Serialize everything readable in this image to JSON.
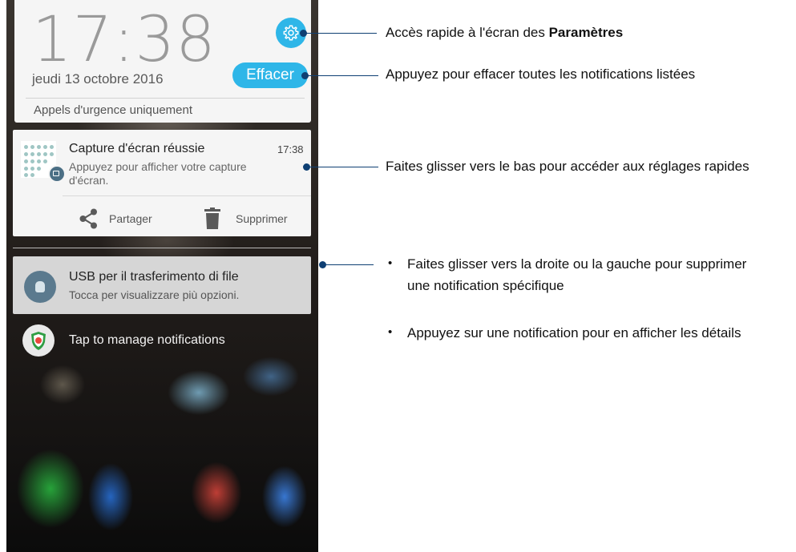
{
  "lockscreen": {
    "time": "17:38",
    "date": "jeudi 13 octobre 2016",
    "clear_label": "Effacer",
    "emergency_text": "Appels d'urgence uniquement"
  },
  "screenshot_notification": {
    "title": "Capture d'écran réussie",
    "time": "17:38",
    "text": "Appuyez pour afficher votre capture d'écran.",
    "share_label": "Partager",
    "delete_label": "Supprimer"
  },
  "usb_notification": {
    "title": "USB per il trasferimento di file",
    "subtitle": "Tocca per visualizzare più opzioni."
  },
  "manage_notifications_label": "Tap to manage notifications",
  "annotations": {
    "settings_prefix": "Accès rapide à l'écran des ",
    "settings_bold": "Paramètres",
    "clear_all": "Appuyez pour effacer toutes les notifications listées",
    "quick_settings": "Faites glisser vers le bas pour accéder aux réglages rapides",
    "bullets": [
      "Faites glisser vers la droite ou la gauche pour supprimer une notification spécifique",
      "Appuyez sur une notification pour en afficher les détails"
    ]
  },
  "colors": {
    "accent": "#2eb6e8",
    "callout": "#0e3f73"
  }
}
